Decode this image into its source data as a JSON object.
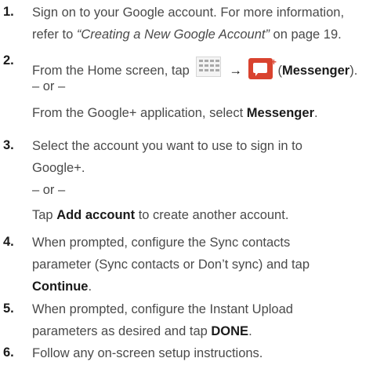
{
  "steps": [
    {
      "number": "1.",
      "lines": [
        "Sign on to your Google account. For more information,",
        {
          "pre": "refer to ",
          "italic": "“Creating a New Google Account”",
          "post": " on page 19."
        }
      ]
    },
    {
      "number": "2.",
      "pre": "From the Home screen, tap ",
      "arrow": "→",
      "bold": "Messenger",
      "paren_open": "(",
      "paren_close": ").",
      "or": "– or –",
      "alt_pre": "From the Google+ application, select ",
      "alt_bold": "Messenger",
      "alt_post": "."
    },
    {
      "number": "3.",
      "line1": "Select the account you want to use to sign in to",
      "line2": "Google+.",
      "or": "– or –",
      "tap": "Tap ",
      "bold": "Add account",
      "post": " to create another account."
    },
    {
      "number": "4.",
      "line1": "When prompted, configure the Sync contacts",
      "line2": "parameter (Sync contacts or Don’t sync) and tap",
      "bold": "Continue",
      "post": "."
    },
    {
      "number": "5.",
      "line1": "When prompted, configure the Instant Upload",
      "pre": "parameters as desired and tap ",
      "bold": "DONE",
      "post": "."
    },
    {
      "number": "6.",
      "line1": "Follow any on-screen setup instructions."
    }
  ],
  "icons": {
    "apps": "apps-grid-icon",
    "messenger": "messenger-icon"
  }
}
